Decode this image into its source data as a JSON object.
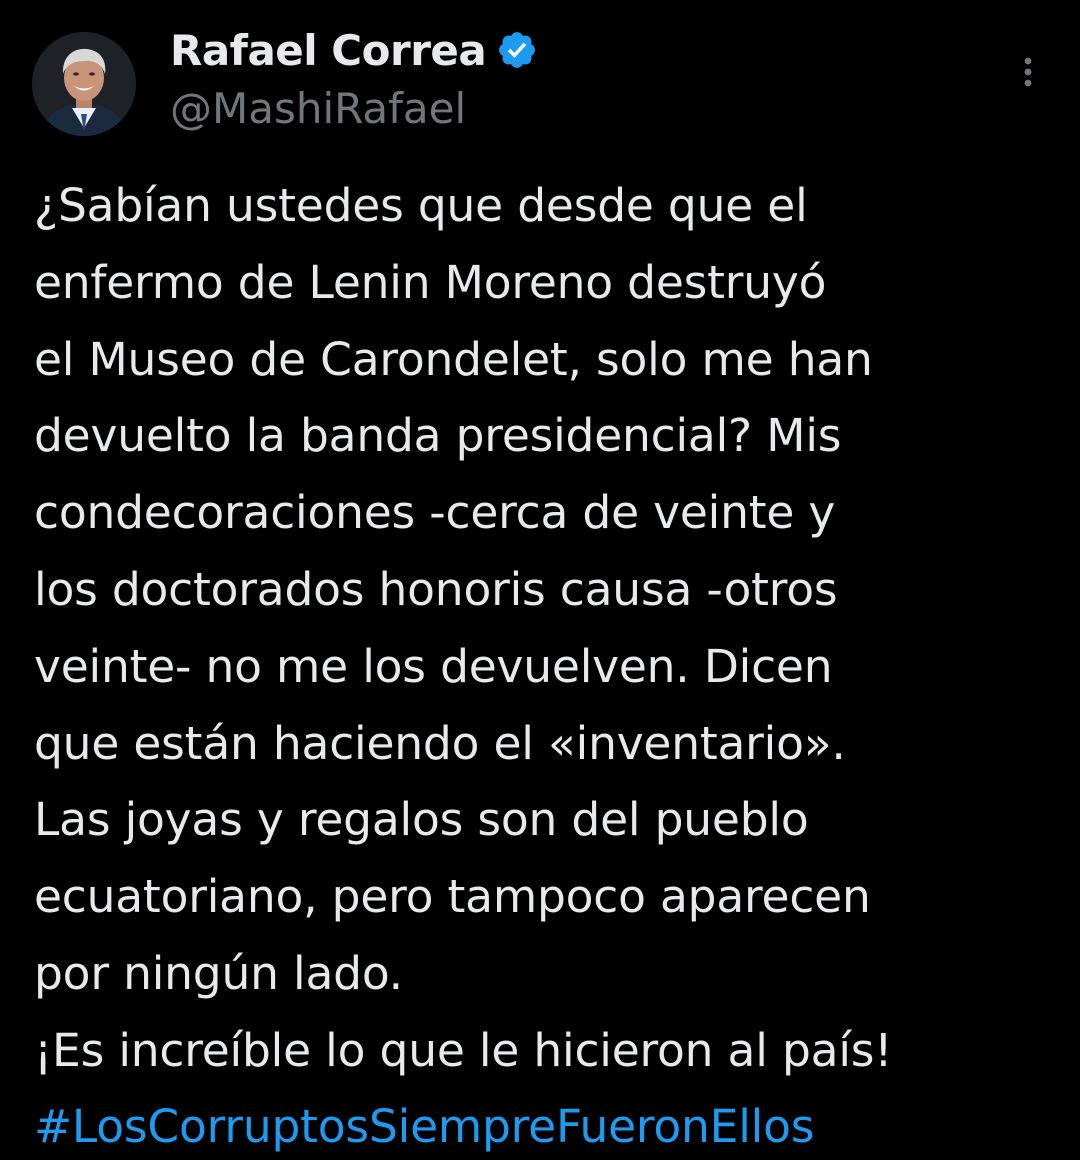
{
  "author": {
    "display_name": "Rafael Correa",
    "handle": "@MashiRafael",
    "verified": true,
    "avatar_icon": "profile-photo"
  },
  "tweet": {
    "text": "¿Sabían ustedes que desde que el\nenfermo de Lenin Moreno destruyó\nel Museo de Carondelet, solo me han\ndevuelto la banda presidencial? Mis\ncondecoraciones -cerca de veinte y\nlos doctorados honoris causa -otros\nveinte- no me los devuelven. Dicen\nque están haciendo el «inventario».\nLas joyas y regalos son del pueblo\necuatoriano, pero tampoco aparecen\npor ningún lado.\n¡Es increíble lo que le hicieron al país!",
    "hashtag": "#LosCorruptosSiempreFueronEllos"
  },
  "icons": {
    "verified": "verified-badge-icon",
    "more": "more-options-icon"
  },
  "colors": {
    "background": "#000000",
    "text": "#e7e9ea",
    "secondary": "#71767b",
    "accent": "#1d9bf0"
  }
}
